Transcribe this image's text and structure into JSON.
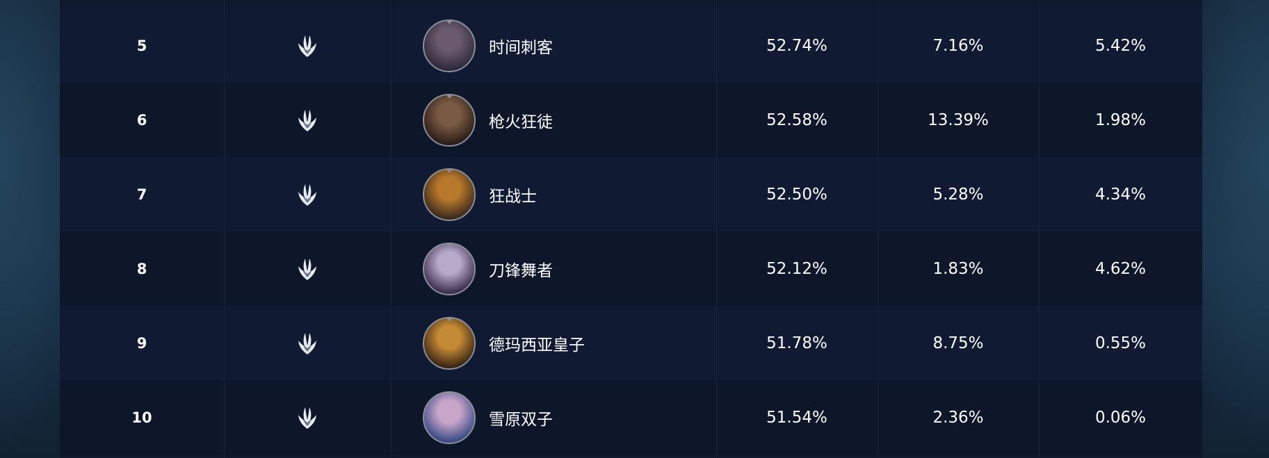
{
  "rows": [
    {
      "rank": "5",
      "hero": "时间刺客",
      "col1": "52.74%",
      "col2": "7.16%",
      "col3": "5.42%",
      "avatar_colors": [
        "#6b5a6e",
        "#2f2a3b"
      ]
    },
    {
      "rank": "6",
      "hero": "枪火狂徒",
      "col1": "52.58%",
      "col2": "13.39%",
      "col3": "1.98%",
      "avatar_colors": [
        "#7a5a42",
        "#2b1c18"
      ]
    },
    {
      "rank": "7",
      "hero": "狂战士",
      "col1": "52.50%",
      "col2": "5.28%",
      "col3": "4.34%",
      "avatar_colors": [
        "#b9792b",
        "#3b2a1d"
      ]
    },
    {
      "rank": "8",
      "hero": "刀锋舞者",
      "col1": "52.12%",
      "col2": "1.83%",
      "col3": "4.62%",
      "avatar_colors": [
        "#b7a9c9",
        "#3d2d4e"
      ]
    },
    {
      "rank": "9",
      "hero": "德玛西亚皇子",
      "col1": "51.78%",
      "col2": "8.75%",
      "col3": "0.55%",
      "avatar_colors": [
        "#c58a35",
        "#3a2614"
      ]
    },
    {
      "rank": "10",
      "hero": "雪原双子",
      "col1": "51.54%",
      "col2": "2.36%",
      "col3": "0.06%",
      "avatar_colors": [
        "#c9a6c9",
        "#394a86"
      ]
    }
  ],
  "tier_icon": "tier-crest-icon",
  "colors": {
    "panel": "#0f182c",
    "row_odd": "#111a33",
    "row_even": "#0e1729",
    "text": "#ffffff",
    "avatar_border": "#8a8f99"
  }
}
